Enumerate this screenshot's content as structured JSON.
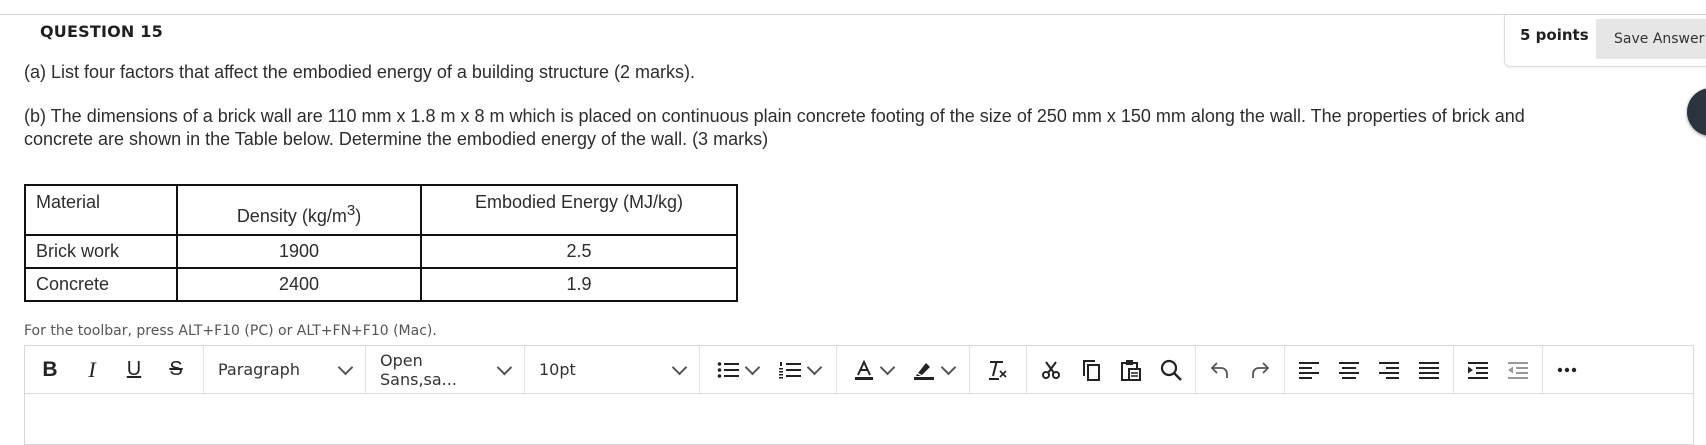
{
  "question": {
    "title": "QUESTION 15",
    "points": "5 points",
    "save_label": "Save Answer",
    "part_a": "(a) List four factors that affect the embodied energy of a building structure (2 marks).",
    "part_b_line1": "(b) The dimensions of a brick wall are 110 mm x 1.8 m x 8 m which is placed on continuous plain concrete footing of the size of 250 mm x 150 mm along the wall. The properties of brick and",
    "part_b_line2": "concrete are shown in the Table below. Determine the embodied energy of the wall. (3 marks)"
  },
  "table": {
    "headers": [
      "Material",
      "Density (kg/m",
      "3",
      ")",
      "Embodied Energy (MJ/kg)"
    ],
    "rows": [
      [
        "Brick work",
        "1900",
        "2.5"
      ],
      [
        "Concrete",
        "2400",
        "1.9"
      ]
    ]
  },
  "editor": {
    "toolbar_hint": "For the toolbar, press ALT+F10 (PC) or ALT+FN+F10 (Mac).",
    "bold": "B",
    "italic": "I",
    "underline": "U",
    "strike": "S",
    "block_format": "Paragraph",
    "font_family": "Open Sans,sa...",
    "font_size": "10pt",
    "icons": [
      "bullet-list-icon",
      "numbered-list-icon",
      "text-color-icon",
      "highlight-icon",
      "clear-format-icon",
      "cut-icon",
      "copy-icon",
      "paste-icon",
      "find-icon",
      "undo-icon",
      "redo-icon",
      "align-left-icon",
      "align-center-icon",
      "align-right-icon",
      "justify-icon",
      "indent-icon",
      "outdent-icon",
      "more-icon"
    ]
  }
}
